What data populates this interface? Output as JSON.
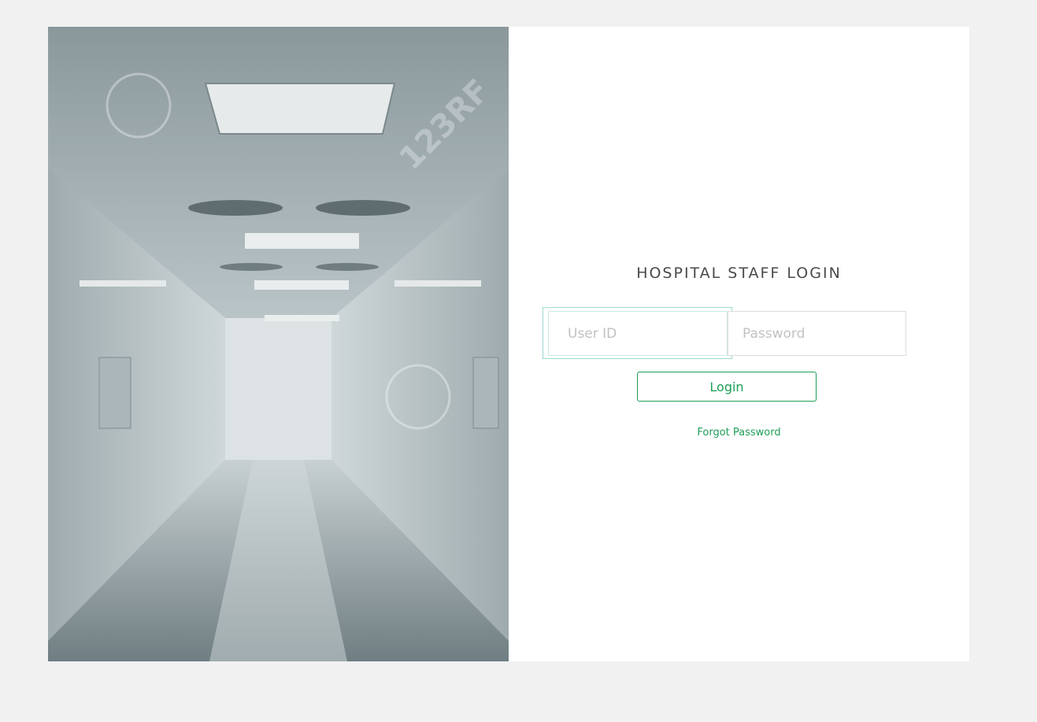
{
  "hero": {
    "image": "hospital-corridor-photo",
    "watermark_text": "123RF"
  },
  "login": {
    "title": "HOSPITAL STAFF LOGIN",
    "user_id_placeholder": "User ID",
    "user_id_value": "",
    "password_placeholder": "Password",
    "password_value": "",
    "login_label": "Login",
    "forgot_label": "Forgot Password"
  },
  "colors": {
    "page_background": "#f1f1f1",
    "card_background": "#ffffff",
    "accent_green": "#1e9e57",
    "focus_outline": "#9adbcf",
    "title_text": "#4a4a4a"
  }
}
